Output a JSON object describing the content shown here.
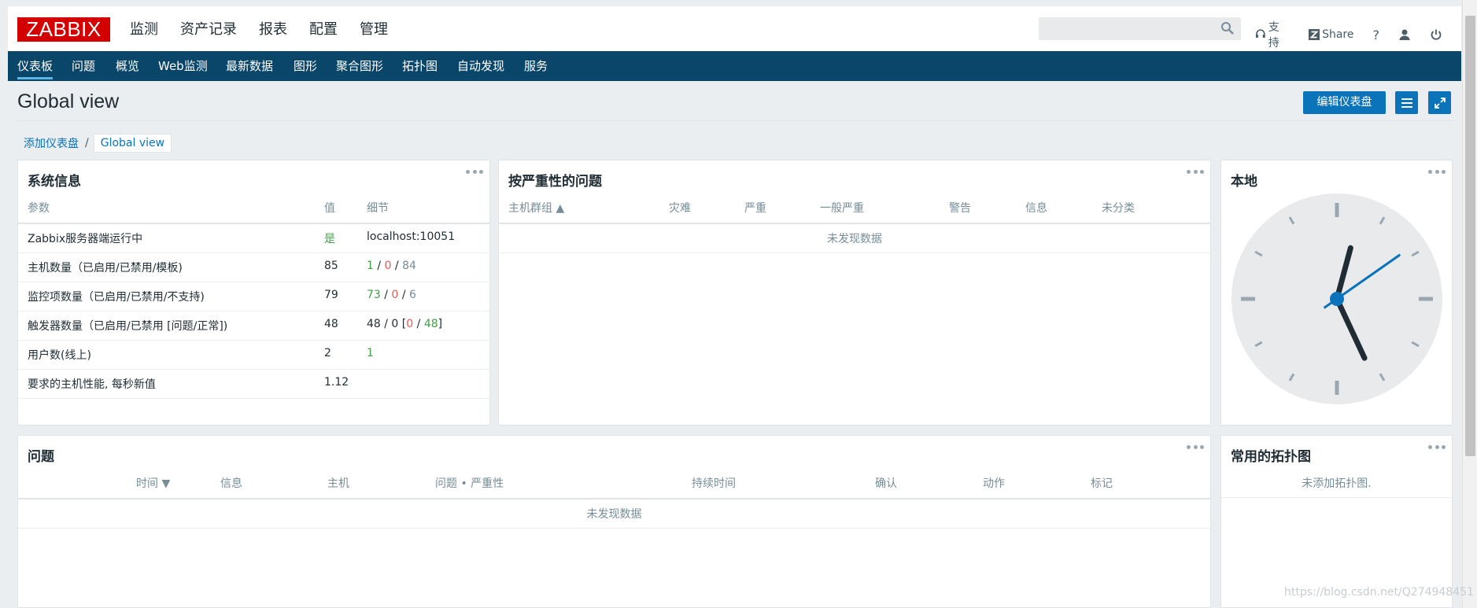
{
  "logo": "ZABBIX",
  "main_menu": [
    "监测",
    "资产记录",
    "报表",
    "配置",
    "管理"
  ],
  "main_menu_active": "监测",
  "top_links": {
    "support": "支持",
    "share": "Share",
    "help": "?"
  },
  "sub_menu": [
    "仪表板",
    "问题",
    "概览",
    "Web监测",
    "最新数据",
    "图形",
    "聚合图形",
    "拓扑图",
    "自动发现",
    "服务"
  ],
  "sub_menu_active": "仪表板",
  "page": {
    "title": "Global view",
    "edit_button": "编辑仪表盘",
    "breadcrumb": {
      "parent": "添加仪表盘",
      "separator": "/",
      "current": "Global view"
    }
  },
  "system_info": {
    "title": "系统信息",
    "headers": {
      "param": "参数",
      "value": "值",
      "details": "细节"
    },
    "rows": [
      {
        "param": "Zabbix服务器端运行中",
        "value": "是",
        "details": "localhost:10051"
      },
      {
        "param": "主机数量（已启用/已禁用/模板)",
        "value": "85",
        "d_a": "1",
        "d_b": "0",
        "d_c": "84",
        "sep": " / "
      },
      {
        "param": "监控项数量（已启用/已禁用/不支持)",
        "value": "79",
        "d_a": "73",
        "d_b": "0",
        "d_c": "6",
        "sep": " / "
      },
      {
        "param": "触发器数量（已启用/已禁用 [问题/正常])",
        "value": "48",
        "d_pre": "48 / 0 [",
        "d_a": "0",
        "d_sep": " / ",
        "d_b": "48",
        "d_post": "]"
      },
      {
        "param": "用户数(线上)",
        "value": "2",
        "details": "1"
      },
      {
        "param": "要求的主机性能, 每秒新值",
        "value": "1.12",
        "details": ""
      }
    ]
  },
  "severity_widget": {
    "title": "按严重性的问题",
    "headers": [
      "主机群组 ▲",
      "灾难",
      "严重",
      "一般严重",
      "警告",
      "信息",
      "未分类"
    ],
    "no_data": "未发现数据"
  },
  "clock_widget": {
    "title": "本地",
    "hour_hand_deg": 15,
    "minute_hand_deg": 155,
    "second_hand_deg": 55
  },
  "problems_widget": {
    "title": "问题",
    "headers": [
      "时间 ▼",
      "信息",
      "主机",
      "问题 • 严重性",
      "持续时间",
      "确认",
      "动作",
      "标记"
    ],
    "no_data": "未发现数据"
  },
  "maps_widget": {
    "title": "常用的拓扑图",
    "no_maps": "未添加拓扑图."
  },
  "watermark": "https://blog.csdn.net/Q274948451",
  "colors": {
    "nav": "#0a466a",
    "accent": "#0a73b9",
    "logo": "#d40000",
    "ok": "#429e47",
    "problem": "#e45959"
  }
}
